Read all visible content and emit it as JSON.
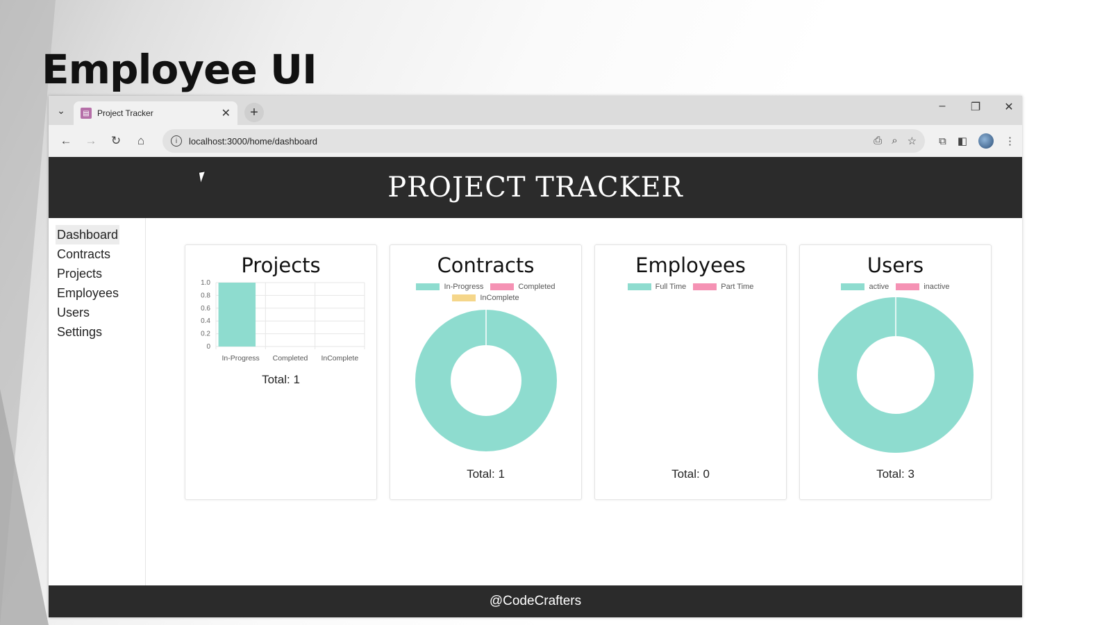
{
  "slide": {
    "title": "Employee UI"
  },
  "browser": {
    "tab_title": "Project Tracker",
    "url": "localhost:3000/home/dashboard"
  },
  "app": {
    "title": "PROJECT TRACKER",
    "footer": "@CodeCrafters"
  },
  "sidebar": {
    "items": [
      {
        "label": "Dashboard"
      },
      {
        "label": "Contracts"
      },
      {
        "label": "Projects"
      },
      {
        "label": "Employees"
      },
      {
        "label": "Users"
      },
      {
        "label": "Settings"
      }
    ]
  },
  "colors": {
    "teal": "#8edccf",
    "pink": "#f592b4",
    "yellow": "#f5d68a",
    "header_bg": "#2b2b2b"
  },
  "cards": [
    {
      "title": "Projects",
      "total": "Total: 1"
    },
    {
      "title": "Contracts",
      "total": "Total: 1",
      "legend": [
        "In-Progress",
        "Completed",
        "InComplete"
      ]
    },
    {
      "title": "Employees",
      "total": "Total: 0",
      "legend": [
        "Full Time",
        "Part Time"
      ]
    },
    {
      "title": "Users",
      "total": "Total: 3",
      "legend": [
        "active",
        "inactive"
      ]
    }
  ],
  "chart_data": [
    {
      "type": "bar",
      "categories": [
        "In-Progress",
        "Completed",
        "InComplete"
      ],
      "values": [
        1,
        0,
        0
      ],
      "ylim": [
        0,
        1.0
      ],
      "yticks": [
        "1.0",
        "0.8",
        "0.6",
        "0.4",
        "0.2",
        "0"
      ],
      "grid": true
    },
    {
      "type": "pie",
      "donut": true,
      "labels": [
        "In-Progress",
        "Completed",
        "InComplete"
      ],
      "values": [
        1,
        0,
        0
      ],
      "legend": "top"
    },
    {
      "type": "pie",
      "donut": true,
      "labels": [
        "Full Time",
        "Part Time"
      ],
      "values": [
        0,
        0
      ],
      "legend": "top"
    },
    {
      "type": "pie",
      "donut": true,
      "labels": [
        "active",
        "inactive"
      ],
      "values": [
        3,
        0
      ],
      "legend": "top"
    }
  ]
}
